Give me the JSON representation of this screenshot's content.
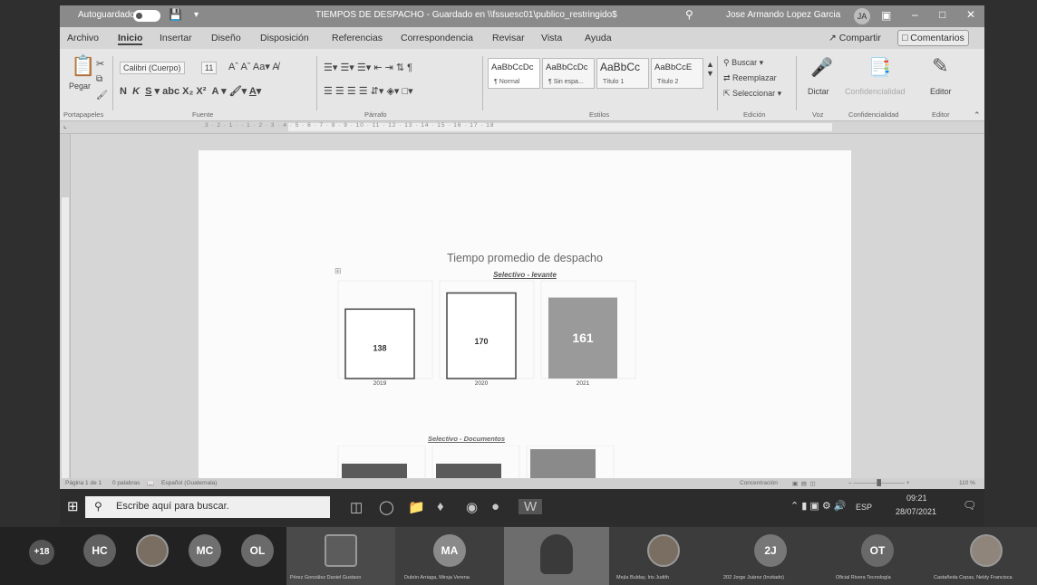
{
  "window": {
    "autosave_label": "Autoguardado",
    "doc_title": "TIEMPOS DE DESPACHO - Guardado en \\\\fssuesc01\\publico_restringido$",
    "user_name": "Jose Armando Lopez Garcia",
    "user_initials": "JA"
  },
  "menu": {
    "tabs": [
      "Archivo",
      "Inicio",
      "Insertar",
      "Diseño",
      "Disposición",
      "Referencias",
      "Correspondencia",
      "Revisar",
      "Vista",
      "Ayuda"
    ],
    "share": "Compartir",
    "comments": "Comentarios"
  },
  "ribbon": {
    "paste": "Pegar",
    "font_name": "Calibri (Cuerpo)",
    "font_size": "11",
    "styles": [
      {
        "sample": "AaBbCcDc",
        "name": "¶ Normal"
      },
      {
        "sample": "AaBbCcDc",
        "name": "¶ Sin espa..."
      },
      {
        "sample": "AaBbCc",
        "name": "Título 1"
      },
      {
        "sample": "AaBbCcE",
        "name": "Título 2"
      }
    ],
    "find": "Buscar",
    "replace": "Reemplazar",
    "select": "Seleccionar",
    "dictate": "Dictar",
    "sensitivity": "Confidencialidad",
    "editor": "Editor",
    "groups": {
      "clipboard": "Portapapeles",
      "font": "Fuente",
      "paragraph": "Párrafo",
      "styles": "Estilos",
      "editing": "Edición",
      "voice": "Voz",
      "sensitivity": "Confidencialidad",
      "editor": "Editor"
    }
  },
  "ruler": {
    "ticks": "3 · 2 · 1 · · 1 · 2 · 3 · 4 · 5 · 6 · 7 · 8 · 9 · 10 · 11 · 12 · 13 · 14 · 15 · 16 · 17 · 18"
  },
  "document": {
    "chart_title": "Tiempo promedio de despacho",
    "chart1_subtitle": "Selectivo - levante",
    "chart2_subtitle": "Selectivo - Documentos"
  },
  "chart_data": [
    {
      "type": "bar",
      "title": "Tiempo promedio de despacho",
      "subtitle": "Selectivo - levante",
      "categories": [
        "2019",
        "2020",
        "2021"
      ],
      "values": [
        138,
        170,
        161
      ],
      "bar_fills": [
        "#ffffff",
        "#ffffff",
        "#9a9a9a"
      ],
      "ylim": [
        0,
        180
      ],
      "grid": false,
      "legend": "none"
    },
    {
      "type": "bar",
      "subtitle": "Selectivo - Documentos",
      "categories": [
        "",
        "",
        ""
      ],
      "values": [
        null,
        null,
        null
      ],
      "bar_fills": [
        "#5a5a5a",
        "#5a5a5a",
        "#8a8a8a"
      ],
      "grid": false,
      "legend": "none"
    }
  ],
  "status": {
    "page": "Página 1 de 1",
    "words": "0 palabras",
    "language": "Español (Guatemala)",
    "focus": "Concentración",
    "zoom": "110 %"
  },
  "taskbar": {
    "search_placeholder": "Escribe aquí para buscar.",
    "lang": "ESP",
    "time": "09:21",
    "date": "28/07/2021"
  },
  "participants": {
    "overflow": "+18",
    "initials": [
      "HC",
      "MC",
      "OL",
      "MA",
      "2J",
      "OT"
    ],
    "names": [
      "Pérez González Daniel Gustavo",
      "Dubón Arriaga, Mirsja Verena",
      "Mejía Bulday, Iris Judith",
      "202 Jorge Juárez (Invitado)",
      "Oficial Rivera Tecnología",
      "Castañeda Cepas, Neldy Francisca"
    ]
  }
}
